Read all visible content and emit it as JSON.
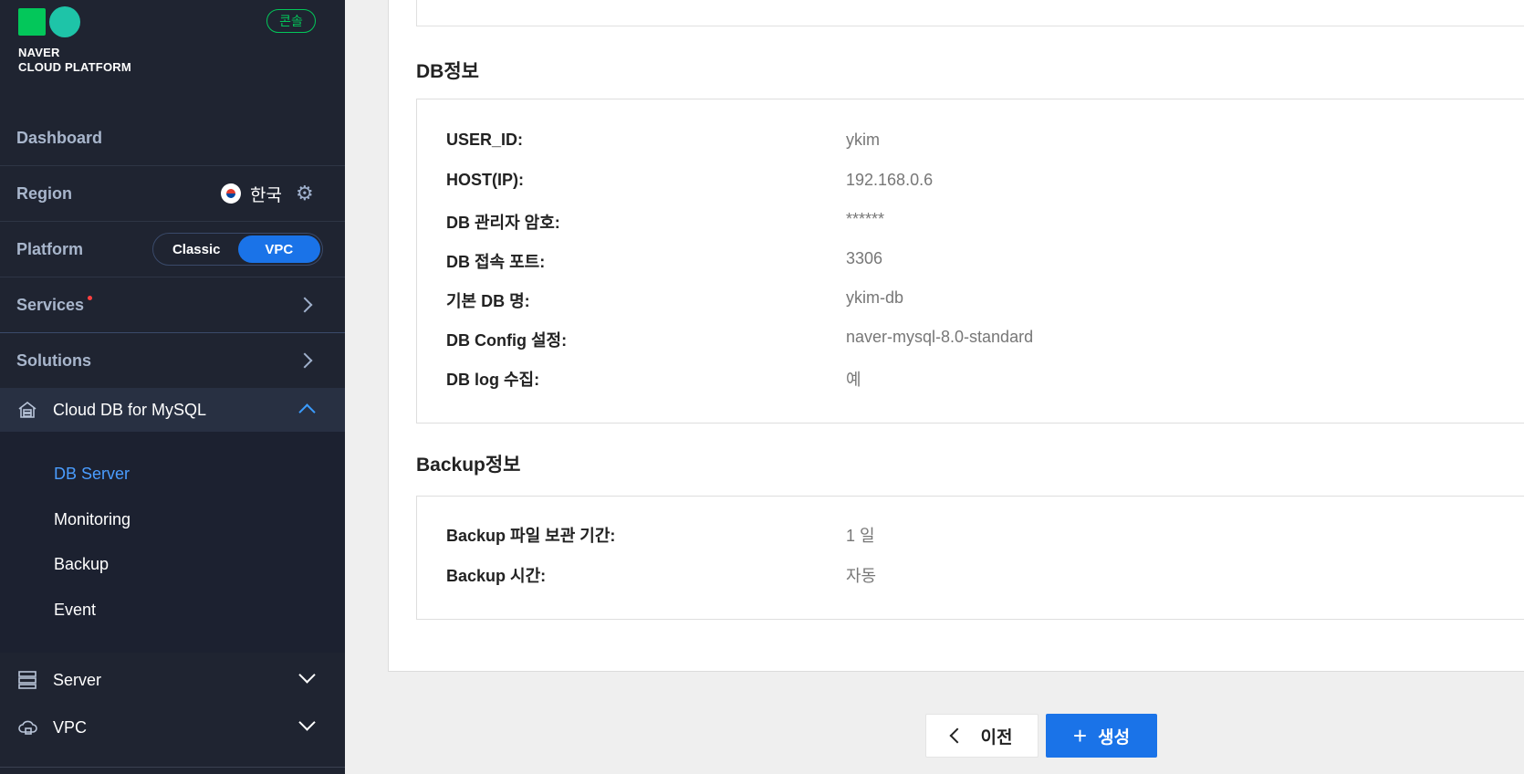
{
  "brand": {
    "line1": "NAVER",
    "line2": "CLOUD PLATFORM",
    "console_badge": "콘솔",
    "color_green": "#03c75a"
  },
  "sidebar": {
    "dashboard": "Dashboard",
    "region": {
      "label": "Region",
      "value": "한국"
    },
    "platform": {
      "label": "Platform",
      "options": [
        "Classic",
        "VPC"
      ],
      "selected": "VPC"
    },
    "services": "Services",
    "solutions": "Solutions",
    "active_group": {
      "label": "Cloud DB for MySQL",
      "items": [
        {
          "label": "DB Server",
          "active": true
        },
        {
          "label": "Monitoring",
          "active": false
        },
        {
          "label": "Backup",
          "active": false
        },
        {
          "label": "Event",
          "active": false
        }
      ]
    },
    "server": "Server",
    "vpc": "VPC"
  },
  "db_info": {
    "title": "DB정보",
    "rows": [
      {
        "label": "USER_ID:",
        "value": "ykim"
      },
      {
        "label": "HOST(IP):",
        "value": "192.168.0.6"
      },
      {
        "label": "DB 관리자 암호:",
        "value": "******"
      },
      {
        "label": "DB 접속 포트:",
        "value": "3306"
      },
      {
        "label": "기본 DB 명:",
        "value": "ykim-db"
      },
      {
        "label": "DB Config 설정:",
        "value": "naver-mysql-8.0-standard"
      },
      {
        "label": "DB log 수집:",
        "value": "예"
      }
    ]
  },
  "backup_info": {
    "title": "Backup정보",
    "rows": [
      {
        "label": "Backup 파일 보관 기간:",
        "value": "1 일"
      },
      {
        "label": "Backup 시간:",
        "value": "자동"
      }
    ]
  },
  "actions": {
    "prev": "이전",
    "create": "생성",
    "accent": "#1a73e8"
  }
}
